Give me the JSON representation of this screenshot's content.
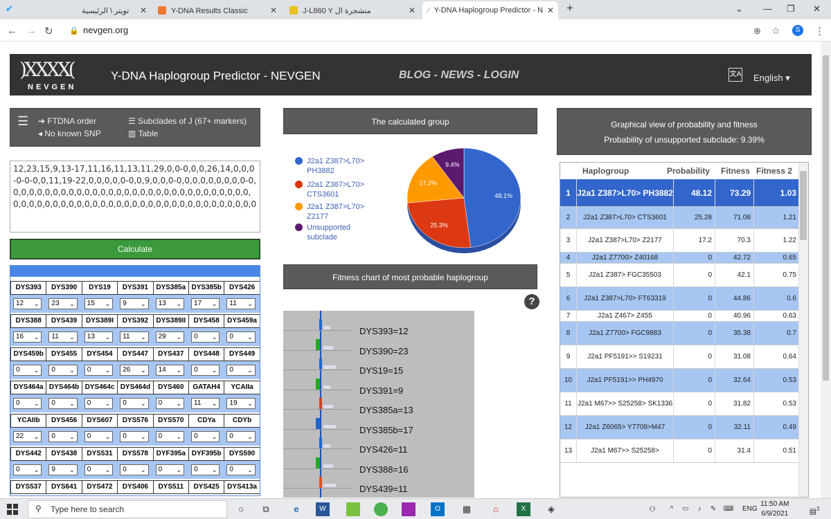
{
  "browser": {
    "tabs": [
      {
        "label": "تويتر \\ الرئيسية",
        "icon": "twitter-icon"
      },
      {
        "label": "Y-DNA Results Classic",
        "icon": "ftdna-icon"
      },
      {
        "label": "J-L860 Y متشجرة ال",
        "icon": "yfull-icon"
      },
      {
        "label": "Y-DNA Haplogroup Predictor - N",
        "icon": "nevgen-icon"
      }
    ],
    "new_tab": "+",
    "url": "nevgen.org",
    "profile_initial": "S"
  },
  "header": {
    "logo_mark": ")XXXX(",
    "logo_sub": "NEVGEN",
    "title": "Y-DNA Haplogroup Predictor - NEVGEN",
    "nav": "BLOG - NEWS - LOGIN",
    "language": "English"
  },
  "options": {
    "ftdna_order": "FTDNA order",
    "no_known_snp": "No known SNP",
    "subclades": "Subclades of J (67+ markers)",
    "table": "Table"
  },
  "markers_input": "12,23,15,9,13-17,11,16,11,13,11,29,0,0-0,0,0,26,14,0,0,0-0-0-0,0,11,19-22,0,0,0,0,0-0,0,9,0,0,0-0,0,0,0,0,0,0,0,0-0,0,0,0,0,0,0,0,0,0,0,0,0,0,0,0,0,0,0,0,0,0,0,0,0,0,0,0,0,0,0,0,0,0,0,0,0,0,0,0,0,0,0,0,0,0,0,0,0,0,0,0,0,0,0,0,0,0,0,0,0,0",
  "calculate_label": "Calculate",
  "str_rows": [
    {
      "labels": [
        "DYS393",
        "DYS390",
        "DYS19",
        "DYS391",
        "DYS385a",
        "DYS385b",
        "DYS426"
      ],
      "values": [
        "12",
        "23",
        "15",
        "9",
        "13",
        "17",
        "11"
      ]
    },
    {
      "labels": [
        "DYS388",
        "DYS439",
        "DYS389I",
        "DYS392",
        "DYS389II",
        "DYS458",
        "DYS459a"
      ],
      "values": [
        "16",
        "11",
        "13",
        "11",
        "29",
        "0",
        "0"
      ]
    },
    {
      "labels": [
        "DYS459b",
        "DYS455",
        "DYS454",
        "DYS447",
        "DYS437",
        "DYS448",
        "DYS449"
      ],
      "values": [
        "0",
        "0",
        "0",
        "26",
        "14",
        "0",
        "0"
      ]
    },
    {
      "labels": [
        "DYS464a",
        "DYS464b",
        "DYS464c",
        "DYS464d",
        "DYS460",
        "GATAH4",
        "YCAIIa"
      ],
      "values": [
        "0",
        "0",
        "0",
        "0",
        "0",
        "11",
        "19"
      ]
    },
    {
      "labels": [
        "YCAIIb",
        "DYS456",
        "DYS607",
        "DYS576",
        "DYS570",
        "CDYa",
        "CDYb"
      ],
      "values": [
        "22",
        "0",
        "0",
        "0",
        "0",
        "0",
        "0"
      ]
    },
    {
      "labels": [
        "DYS442",
        "DYS438",
        "DYS531",
        "DYS578",
        "DYF395a",
        "DYF395b",
        "DYS590"
      ],
      "values": [
        "0",
        "9",
        "0",
        "0",
        "0",
        "0",
        "0"
      ]
    },
    {
      "labels": [
        "DYS537",
        "DYS641",
        "DYS472",
        "DYS406",
        "DYS511",
        "DYS425",
        "DYS413a"
      ],
      "values": []
    }
  ],
  "panels": {
    "calculated_group": "The calculated group",
    "graph_title": "Graphical view of probability and fitness",
    "unsupported_text": "Probability of unsupported subclade: 9.39%",
    "fitness_title": "Fitness chart of most probable haplogroup"
  },
  "chart_data": [
    {
      "type": "pie",
      "title": "The calculated group",
      "slices": [
        {
          "name": "J2a1 Z387>L70> PH3882",
          "value": 48.1,
          "label": "48.1%",
          "color": "#3366cc"
        },
        {
          "name": "J2a1 Z387>L70> CTS3601",
          "value": 25.3,
          "label": "25.3%",
          "color": "#dc3912"
        },
        {
          "name": "J2a1 Z387>L70> Z2177",
          "value": 17.2,
          "label": "17.2%",
          "color": "#ff9900"
        },
        {
          "name": "Unsupported subclade",
          "value": 9.4,
          "label": "9.4%",
          "color": "#5c1a6e"
        }
      ],
      "legend_position": "left"
    },
    {
      "type": "bar",
      "title": "Fitness chart of most probable haplogroup",
      "categories": [
        "DYS393=12",
        "DYS390=23",
        "DYS19=15",
        "DYS391=9",
        "DYS385a=13",
        "DYS385b=17",
        "DYS426=11",
        "DYS388=16",
        "DYS439=11"
      ]
    }
  ],
  "prob_table": {
    "headers": [
      "Haplogroup",
      "Probability",
      "Fitness",
      "Fitness 2"
    ],
    "rows": [
      {
        "n": "1",
        "hap": "J2a1 Z387>L70> PH3882",
        "prob": "48.12",
        "fit": "73.29",
        "fit2": "1.03",
        "highlight": true
      },
      {
        "n": "2",
        "hap": "J2a1 Z387>L70> CTS3601",
        "prob": "25.28",
        "fit": "71.08",
        "fit2": "1.21"
      },
      {
        "n": "3",
        "hap": "J2a1 Z387>L70> Z2177",
        "prob": "17.2",
        "fit": "70.3",
        "fit2": "1.22"
      },
      {
        "n": "4",
        "hap": "J2a1 Z7700> Z40168",
        "prob": "0",
        "fit": "42.72",
        "fit2": "0.65"
      },
      {
        "n": "5",
        "hap": "J2a1 Z387> FGC35503",
        "prob": "0",
        "fit": "42.1",
        "fit2": "0.75"
      },
      {
        "n": "6",
        "hap": "J2a1 Z387>L70> FT63319",
        "prob": "0",
        "fit": "44.86",
        "fit2": "0.6"
      },
      {
        "n": "7",
        "hap": "J2a1 Z467> Z455",
        "prob": "0",
        "fit": "40.96",
        "fit2": "0.63"
      },
      {
        "n": "8",
        "hap": "J2a1 Z7700> FGC9883",
        "prob": "0",
        "fit": "35.38",
        "fit2": "0.7"
      },
      {
        "n": "9",
        "hap": "J2a1 PF5191>> S19231",
        "prob": "0",
        "fit": "31.08",
        "fit2": "0.64"
      },
      {
        "n": "10",
        "hap": "J2a1 PF5191>> PH4970",
        "prob": "0",
        "fit": "32.64",
        "fit2": "0.53"
      },
      {
        "n": "11",
        "hap": "J2a1 M67>> S25258> SK1336",
        "prob": "0",
        "fit": "31.82",
        "fit2": "0.53"
      },
      {
        "n": "12",
        "hap": "J2a1 Z6065> Y7708>M47",
        "prob": "0",
        "fit": "32.11",
        "fit2": "0.49"
      },
      {
        "n": "13",
        "hap": "J2a1 M67>> S25258>",
        "prob": "0",
        "fit": "31.4",
        "fit2": "0.51"
      }
    ]
  },
  "taskbar": {
    "search_placeholder": "Type here to search",
    "lang": "ENG",
    "time": "11:50 AM",
    "date": "6/9/2021",
    "notifications": "3"
  },
  "colors": {
    "header_bg": "#333333",
    "panel_bg": "#5a5a5a",
    "calc_green": "#3c9a3c",
    "row_blue": "#a7c6f2",
    "row_highlight": "#3366cc"
  }
}
